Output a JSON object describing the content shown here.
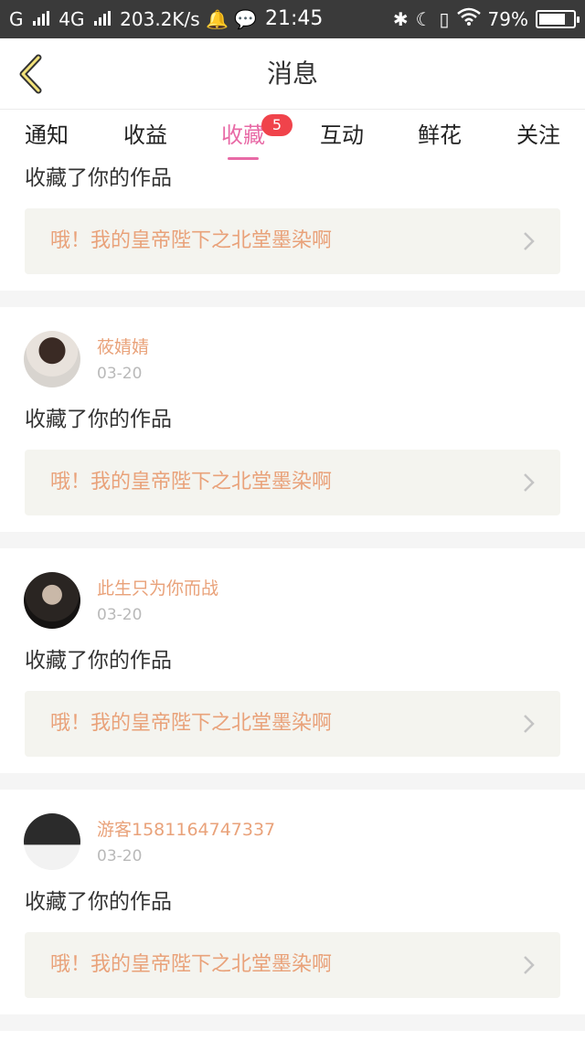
{
  "status_bar": {
    "left_text": "G",
    "network_label": "4G",
    "speed": "203.2K/s",
    "time": "21:45",
    "battery": "79%",
    "battery_level": 0.79
  },
  "header": {
    "title": "消息"
  },
  "tabs": [
    {
      "label": "通知",
      "active": false
    },
    {
      "label": "收益",
      "active": false
    },
    {
      "label": "收藏",
      "active": true,
      "badge": "5"
    },
    {
      "label": "互动",
      "active": false
    },
    {
      "label": "鲜花",
      "active": false
    },
    {
      "label": "关注",
      "active": false
    }
  ],
  "items": [
    {
      "user": "",
      "date": "",
      "action": "收藏了你的作品",
      "work_title": "哦！我的皇帝陛下之北堂墨染啊"
    },
    {
      "user": "莜婧婧",
      "date": "03-20",
      "action": "收藏了你的作品",
      "work_title": "哦！我的皇帝陛下之北堂墨染啊"
    },
    {
      "user": "此生只为你而战",
      "date": "03-20",
      "action": "收藏了你的作品",
      "work_title": "哦！我的皇帝陛下之北堂墨染啊"
    },
    {
      "user": "游客1581164747337",
      "date": "03-20",
      "action": "收藏了你的作品",
      "work_title": "哦！我的皇帝陛下之北堂墨染啊"
    }
  ],
  "colors": {
    "accent": "#e86aa6",
    "username": "#e9a27a",
    "badge": "#f0434b"
  }
}
